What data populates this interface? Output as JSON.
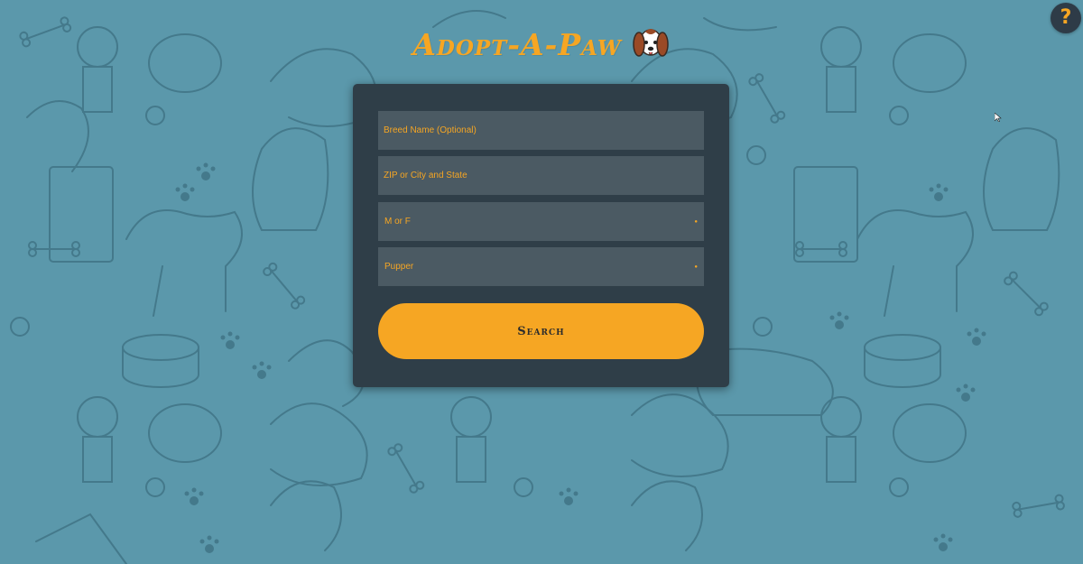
{
  "app": {
    "title": "Adopt-A-Paw",
    "logo_icon": "dog-face-icon"
  },
  "help": {
    "label": "?",
    "icon": "question-icon"
  },
  "form": {
    "breed": {
      "placeholder": "Breed Name (Optional)"
    },
    "location": {
      "placeholder": "ZIP or City and State"
    },
    "sex": {
      "value": "M or F"
    },
    "age": {
      "value": "Pupper"
    },
    "search_label": "Search"
  },
  "colors": {
    "background": "#5b98ab",
    "panel": "#2f3e48",
    "field": "#4b5a63",
    "accent": "#f6a623"
  }
}
